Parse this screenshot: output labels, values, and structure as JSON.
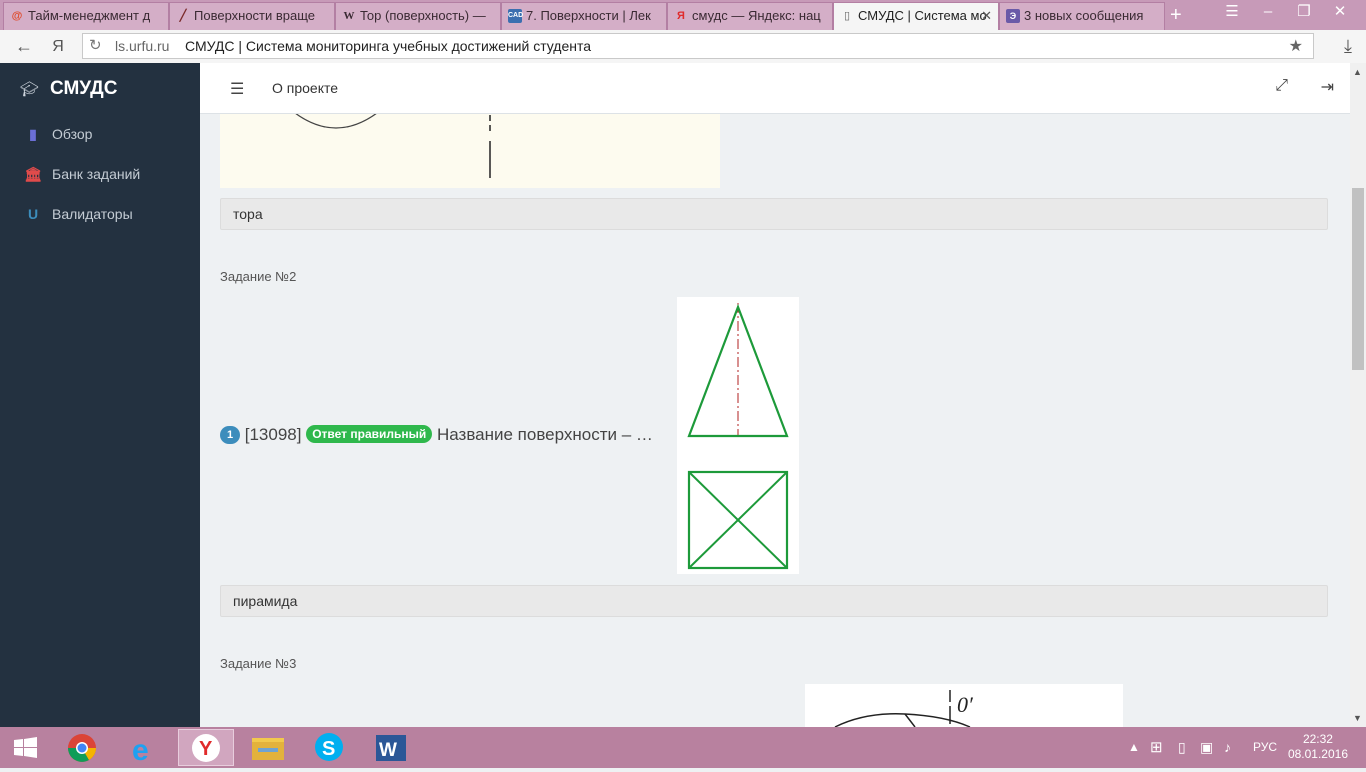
{
  "browser": {
    "tabs": [
      {
        "label": "Тайм-менеджмент д",
        "icon": "spiral-icon"
      },
      {
        "label": "Поверхности враще",
        "icon": "pen-icon"
      },
      {
        "label": "Тор (поверхность) —",
        "icon": "wikipedia-icon"
      },
      {
        "label": "7. Поверхности | Лек",
        "icon": "cad-icon"
      },
      {
        "label": "смудс — Яндекс: нац",
        "icon": "yandex-icon"
      },
      {
        "label": "СМУДС | Система мо",
        "icon": "page-icon"
      },
      {
        "label": "3 новых сообщения",
        "icon": "mail-icon"
      }
    ],
    "address": {
      "domain": "ls.urfu.ru",
      "page_title": "СМУДС | Система мониторинга учебных достижений студента"
    }
  },
  "sidebar": {
    "brand": "СМУДС",
    "items": [
      {
        "label": "Обзор",
        "icon": "bar-chart-icon",
        "color": "#6b6fd6"
      },
      {
        "label": "Банк заданий",
        "icon": "bank-icon",
        "color": "#e04b4b"
      },
      {
        "label": "Валидаторы",
        "icon": "magnet-icon",
        "color": "#3c8dbc"
      }
    ]
  },
  "header": {
    "about_label": "О проекте"
  },
  "content": {
    "task1_answer": "тора",
    "task2": {
      "title": "Задание №2",
      "number": "1",
      "id": "[13098]",
      "status": "Ответ правильный",
      "question": "Название поверхности – …",
      "answer": "пирамида"
    },
    "task3": {
      "title": "Задание №3",
      "figure_label": "0′"
    }
  },
  "taskbar": {
    "lang": "РУС",
    "time": "22:32",
    "date": "08.01.2016"
  }
}
